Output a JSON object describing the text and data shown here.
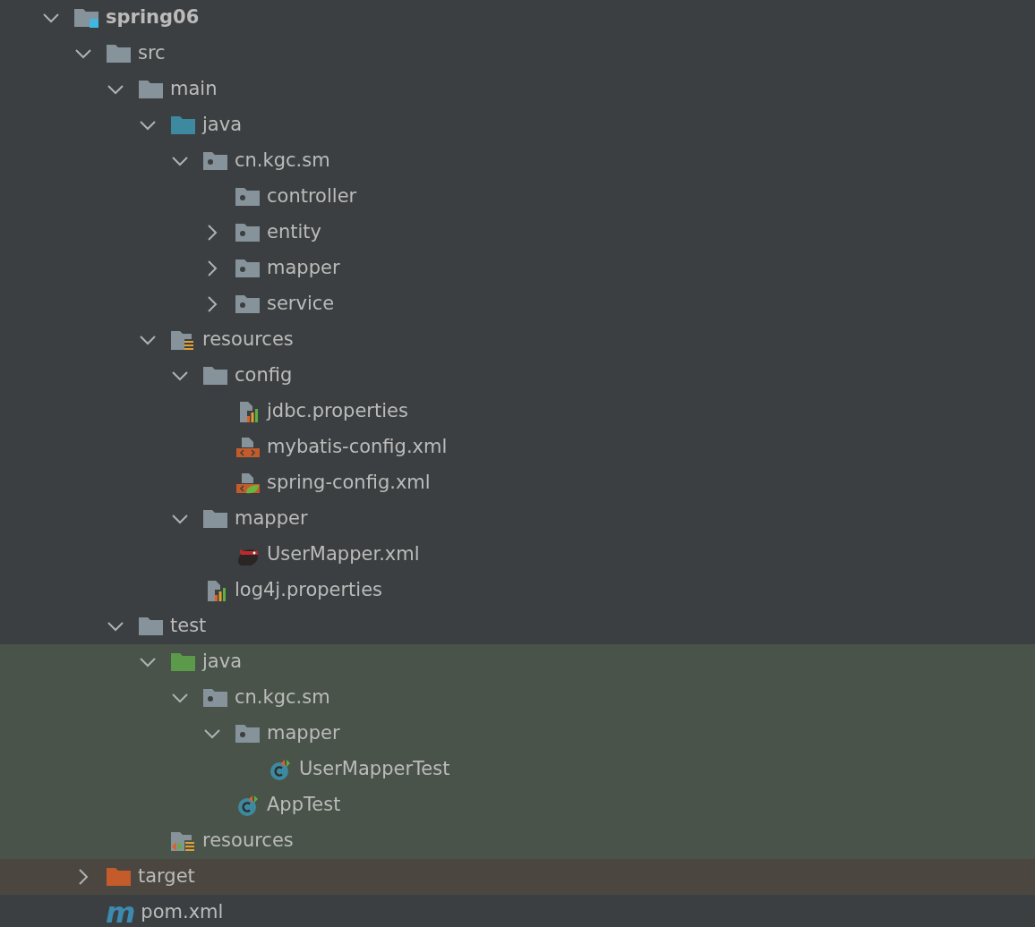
{
  "tree": [
    {
      "label": "spring06",
      "kind": "module",
      "expanded": true,
      "children": [
        {
          "label": "src",
          "kind": "folder",
          "expanded": true,
          "children": [
            {
              "label": "main",
              "kind": "folder",
              "expanded": true,
              "children": [
                {
                  "label": "java",
                  "kind": "source-folder",
                  "expanded": true,
                  "children": [
                    {
                      "label": "cn.kgc.sm",
                      "kind": "package",
                      "expanded": true,
                      "children": [
                        {
                          "label": "controller",
                          "kind": "package"
                        },
                        {
                          "label": "entity",
                          "kind": "package",
                          "expanded": false
                        },
                        {
                          "label": "mapper",
                          "kind": "package",
                          "expanded": false
                        },
                        {
                          "label": "service",
                          "kind": "package",
                          "expanded": false
                        }
                      ]
                    }
                  ]
                },
                {
                  "label": "resources",
                  "kind": "resources-folder",
                  "expanded": true,
                  "children": [
                    {
                      "label": "config",
                      "kind": "folder",
                      "expanded": true,
                      "children": [
                        {
                          "label": "jdbc.properties",
                          "kind": "properties"
                        },
                        {
                          "label": "mybatis-config.xml",
                          "kind": "xml"
                        },
                        {
                          "label": "spring-config.xml",
                          "kind": "spring-xml"
                        }
                      ]
                    },
                    {
                      "label": "mapper",
                      "kind": "folder",
                      "expanded": true,
                      "children": [
                        {
                          "label": "UserMapper.xml",
                          "kind": "mybatis-xml"
                        }
                      ]
                    },
                    {
                      "label": "log4j.properties",
                      "kind": "properties"
                    }
                  ]
                }
              ]
            },
            {
              "label": "test",
              "kind": "folder",
              "expanded": true,
              "children": [
                {
                  "label": "java",
                  "kind": "test-folder",
                  "test_root": true,
                  "expanded": true,
                  "children": [
                    {
                      "label": "cn.kgc.sm",
                      "kind": "package",
                      "test_root": true,
                      "expanded": true,
                      "children": [
                        {
                          "label": "mapper",
                          "kind": "package",
                          "test_root": true,
                          "expanded": true,
                          "children": [
                            {
                              "label": "UserMapperTest",
                              "kind": "test-class",
                              "test_root": true
                            }
                          ]
                        },
                        {
                          "label": "AppTest",
                          "kind": "test-class",
                          "test_root": true
                        }
                      ]
                    }
                  ]
                },
                {
                  "label": "resources",
                  "kind": "test-resources",
                  "test_root": true
                }
              ]
            }
          ]
        },
        {
          "label": "target",
          "kind": "excluded-folder",
          "excluded": true,
          "expanded": false
        },
        {
          "label": "pom.xml",
          "kind": "maven",
          "glyph": "m"
        }
      ]
    }
  ]
}
